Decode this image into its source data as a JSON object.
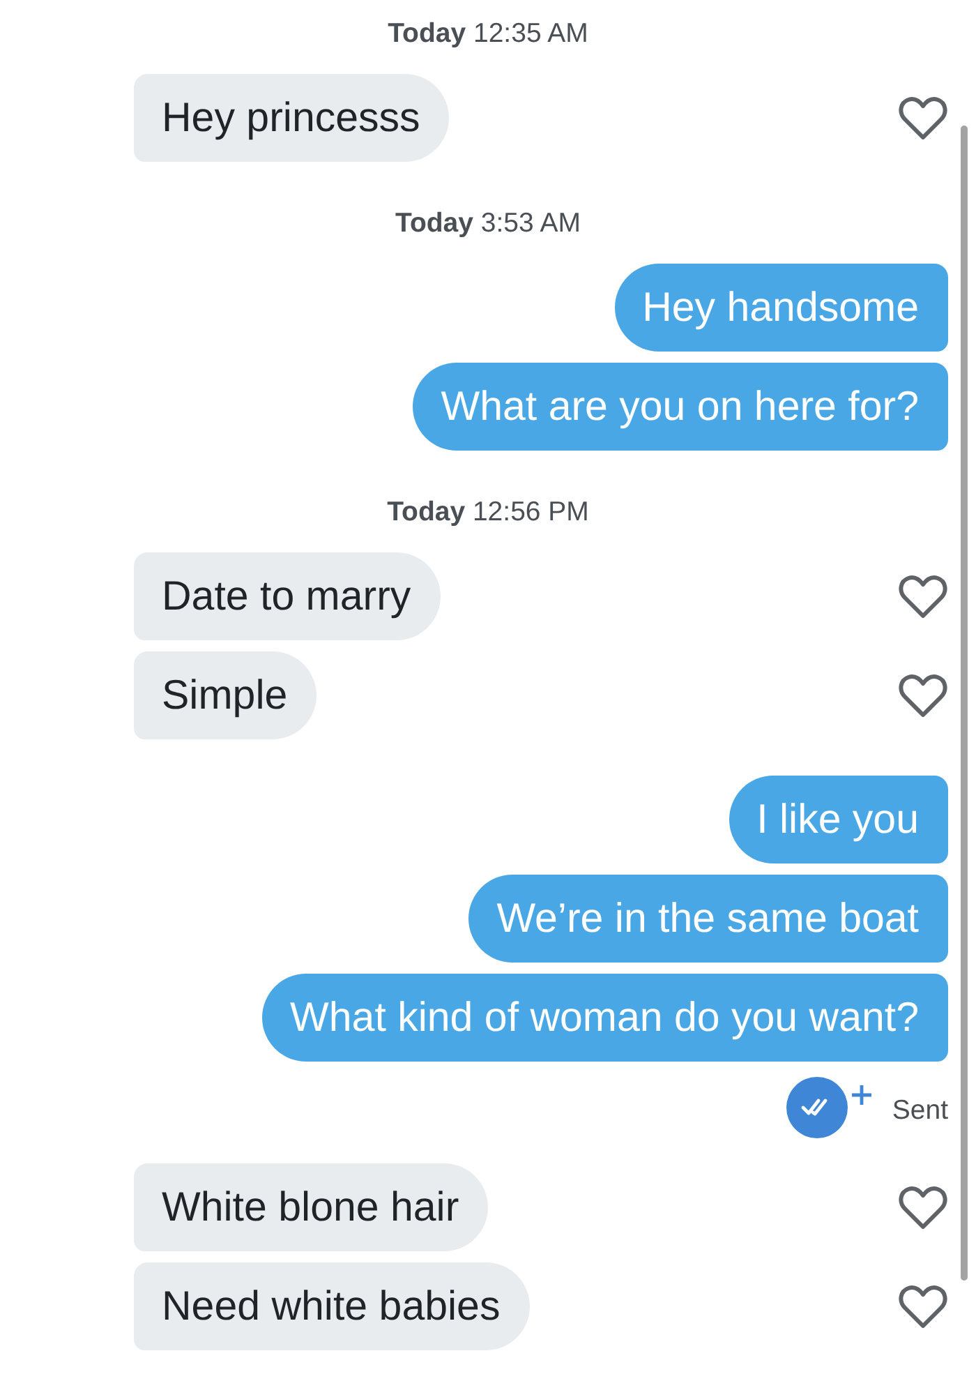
{
  "thread": [
    {
      "kind": "timestamp",
      "text": "**Today** 12:35 AM"
    },
    {
      "kind": "incoming",
      "text": "Hey princesss",
      "liked": false
    },
    {
      "kind": "timestamp",
      "text": "**Today** 3:53 AM"
    },
    {
      "kind": "outgoing",
      "text": "Hey handsome"
    },
    {
      "kind": "outgoing",
      "text": "What are you on here for?"
    },
    {
      "kind": "timestamp",
      "text": "**Today** 12:56 PM"
    },
    {
      "kind": "incoming",
      "text": "Date to marry",
      "liked": false
    },
    {
      "kind": "incoming",
      "text": "Simple",
      "liked": false
    },
    {
      "kind": "outgoing",
      "text": "I like you"
    },
    {
      "kind": "outgoing",
      "text": "We’re in the same boat"
    },
    {
      "kind": "outgoing",
      "text": "What kind of woman do you want?"
    },
    {
      "kind": "receipt",
      "label": "Sent"
    },
    {
      "kind": "incoming",
      "text": "White blone hair",
      "liked": false
    },
    {
      "kind": "incoming",
      "text": "Need white babies",
      "liked": false
    }
  ]
}
